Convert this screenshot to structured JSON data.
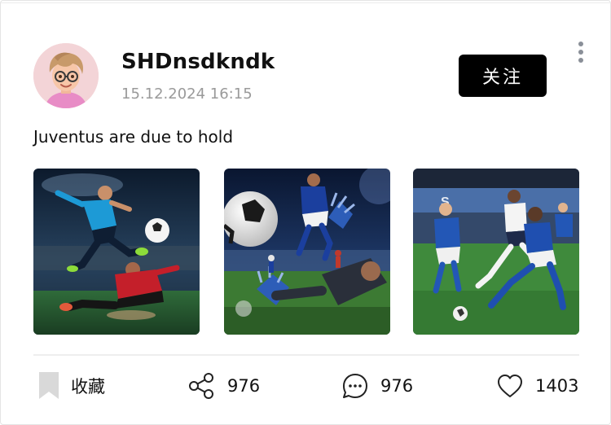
{
  "post": {
    "author": "SHDnsdkndk",
    "timestamp": "15.12.2024 16:15",
    "follow_label": "关注",
    "text": "Juventus are due to hold",
    "images": [
      {
        "subject": "soccer-player-kicking-ball"
      },
      {
        "subject": "goalkeeper-ball-closeup"
      },
      {
        "subject": "match-action-players"
      }
    ]
  },
  "actions": {
    "favorite_label": "收藏",
    "share_count": "976",
    "comment_count": "976",
    "like_count": "1403"
  },
  "icons": {
    "more": "more-vertical-icon",
    "favorite": "bookmark-icon",
    "share": "share-icon",
    "comment": "comment-icon",
    "like": "heart-icon"
  },
  "colors": {
    "accent": "#000000",
    "muted": "#9a9a9a",
    "icon": "#222222",
    "bookmark": "#d9d9d9"
  }
}
